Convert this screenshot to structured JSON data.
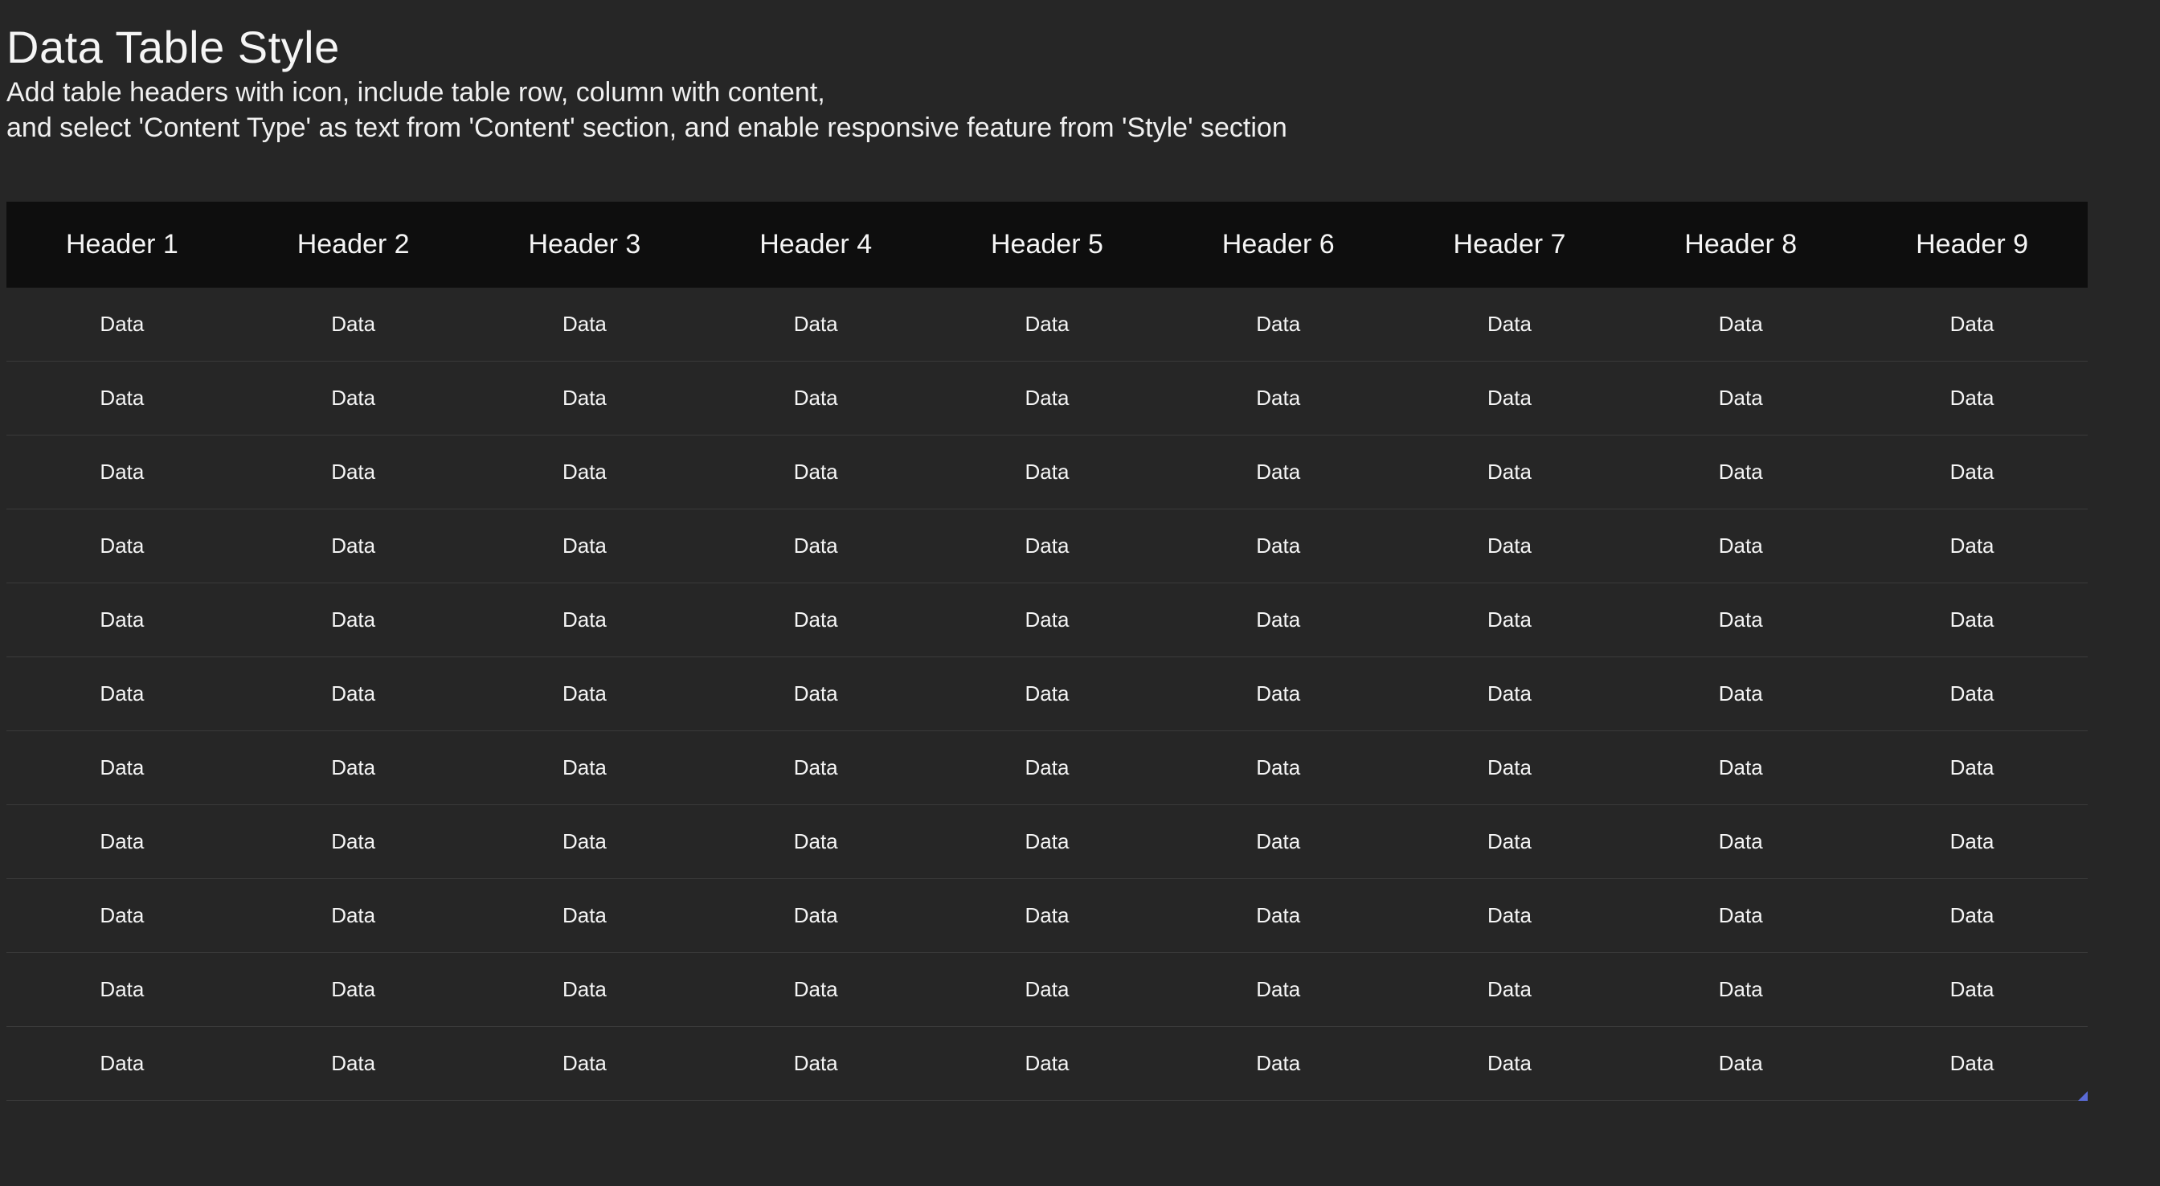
{
  "page": {
    "title": "Data Table Style",
    "subtitle_line1": "Add table headers with icon, include table row, column with content,",
    "subtitle_line2": "and select 'Content Type' as text from 'Content' section, and enable responsive feature from 'Style' section"
  },
  "table": {
    "headers": [
      "Header 1",
      "Header 2",
      "Header 3",
      "Header 4",
      "Header 5",
      "Header 6",
      "Header 7",
      "Header 8",
      "Header 9"
    ],
    "rows": [
      [
        "Data",
        "Data",
        "Data",
        "Data",
        "Data",
        "Data",
        "Data",
        "Data",
        "Data"
      ],
      [
        "Data",
        "Data",
        "Data",
        "Data",
        "Data",
        "Data",
        "Data",
        "Data",
        "Data"
      ],
      [
        "Data",
        "Data",
        "Data",
        "Data",
        "Data",
        "Data",
        "Data",
        "Data",
        "Data"
      ],
      [
        "Data",
        "Data",
        "Data",
        "Data",
        "Data",
        "Data",
        "Data",
        "Data",
        "Data"
      ],
      [
        "Data",
        "Data",
        "Data",
        "Data",
        "Data",
        "Data",
        "Data",
        "Data",
        "Data"
      ],
      [
        "Data",
        "Data",
        "Data",
        "Data",
        "Data",
        "Data",
        "Data",
        "Data",
        "Data"
      ],
      [
        "Data",
        "Data",
        "Data",
        "Data",
        "Data",
        "Data",
        "Data",
        "Data",
        "Data"
      ],
      [
        "Data",
        "Data",
        "Data",
        "Data",
        "Data",
        "Data",
        "Data",
        "Data",
        "Data"
      ],
      [
        "Data",
        "Data",
        "Data",
        "Data",
        "Data",
        "Data",
        "Data",
        "Data",
        "Data"
      ],
      [
        "Data",
        "Data",
        "Data",
        "Data",
        "Data",
        "Data",
        "Data",
        "Data",
        "Data"
      ],
      [
        "Data",
        "Data",
        "Data",
        "Data",
        "Data",
        "Data",
        "Data",
        "Data",
        "Data"
      ]
    ]
  }
}
